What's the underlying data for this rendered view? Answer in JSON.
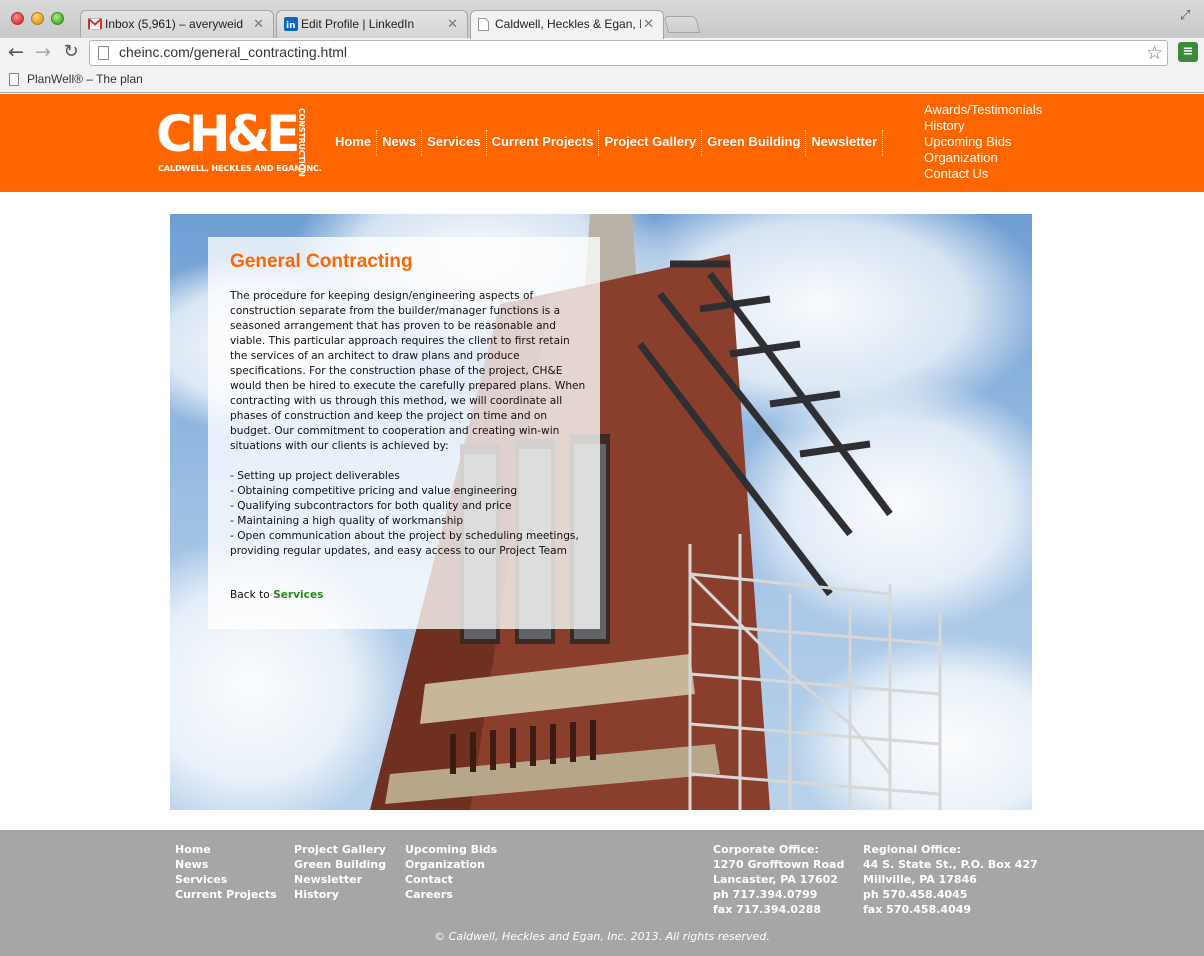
{
  "browser": {
    "tabs": [
      {
        "title": "Inbox (5,961) – averyweid",
        "favicon": "gmail-icon"
      },
      {
        "title": "Edit Profile | LinkedIn",
        "favicon": "linkedin-icon"
      },
      {
        "title": "Caldwell, Heckles & Egan, I",
        "favicon": "page-icon"
      }
    ],
    "url": "cheinc.com/general_contracting.html",
    "bookmarks": [
      {
        "label": "PlanWell® – The plan"
      }
    ]
  },
  "site": {
    "colors": {
      "brand": "#ff6600",
      "link": "#2a8a1e",
      "footer": "#a6a6a6"
    },
    "logo": {
      "main": "CH&E",
      "vertical": "CONSTRUCTION",
      "sub": "CALDWELL, HECKLES AND EGAN INC."
    },
    "main_nav": [
      "Home",
      "News",
      "Services",
      "Current Projects",
      "Project Gallery",
      "Green Building",
      "Newsletter"
    ],
    "side_nav": [
      "Awards/Testimonials",
      "History",
      "Upcoming Bids",
      "Organization",
      "Contact Us"
    ]
  },
  "content": {
    "title": "General Contracting",
    "body": "The procedure for keeping design/engineering aspects of construction separate from the builder/manager functions is a seasoned arrangement that has proven to be reasonable and viable. This particular approach requires the client to first retain the services of an architect to draw plans and produce specifications. For the construction phase of the project, CH&E would then be hired to execute the carefully prepared plans. When contracting with us through this method, we will coordinate all phases of construction and keep the project on time and on budget. Our commitment to cooperation and creating win-win situations with our clients is achieved by:",
    "bullets": [
      "- Setting up project deliverables",
      "- Obtaining competitive pricing and value engineering",
      "- Qualifying subcontractors for both quality and price",
      "- Maintaining a high quality of workmanship",
      "- Open communication about the project by scheduling meetings, providing regular updates, and easy access to our Project Team"
    ],
    "back_prefix": "Back to",
    "back_link": "Services"
  },
  "footer": {
    "col1": [
      "Home",
      "News",
      "Services",
      "Current Projects"
    ],
    "col2": [
      "Project Gallery",
      "Green Building",
      "Newsletter",
      "History"
    ],
    "col3": [
      "Upcoming Bids",
      "Organization",
      "Contact",
      "Careers"
    ],
    "corporate": [
      "Corporate Office:",
      "1270 Grofftown Road",
      "Lancaster, PA 17602",
      "ph 717.394.0799",
      "fax 717.394.0288"
    ],
    "regional": [
      "Regional Office:",
      "44 S. State St., P.O. Box 427",
      "Millville, PA 17846",
      "ph 570.458.4045",
      "fax 570.458.4049"
    ],
    "copyright": "© Caldwell, Heckles and Egan, Inc. 2013. All rights reserved."
  }
}
